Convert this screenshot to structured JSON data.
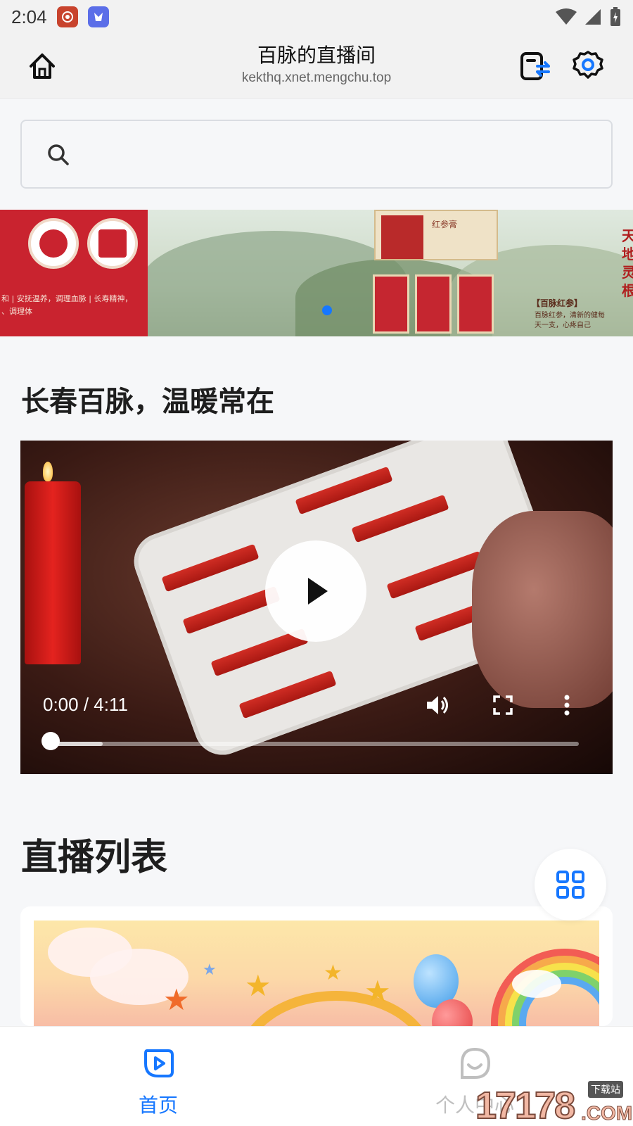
{
  "status_bar": {
    "time": "2:04"
  },
  "header": {
    "title": "百脉的直播间",
    "url": "kekthq.xnet.mengchu.top"
  },
  "search": {
    "placeholder": "",
    "value": ""
  },
  "banner": {
    "left_text": "和 | 安抚温养，调理血脉 | 长寿精神，\n、调理体",
    "right_text": "天地灵根",
    "box_label": "红参膏",
    "caption_title": "【百脉红参】",
    "caption_sub": "百脉红参，清新的健每天一支，心疼自己",
    "active_slide": 1,
    "slide_count": 1
  },
  "section1": {
    "title": "长春百脉，温暖常在"
  },
  "video": {
    "time_label": "0:00 / 4:11",
    "progress": 0.0,
    "buffered": 0.1
  },
  "section2": {
    "title": "直播列表"
  },
  "bottom_nav": {
    "items": [
      {
        "label": "首页",
        "icon": "play-circle-icon",
        "active": true
      },
      {
        "label": "个人中心",
        "icon": "smile-face-icon",
        "active": false
      }
    ]
  },
  "watermark": {
    "text": "17178",
    "badge": "下载站",
    "suffix": ".COM"
  },
  "colors": {
    "accent": "#1677ff",
    "background": "#f6f7f9",
    "banner_red": "#c9232f"
  }
}
